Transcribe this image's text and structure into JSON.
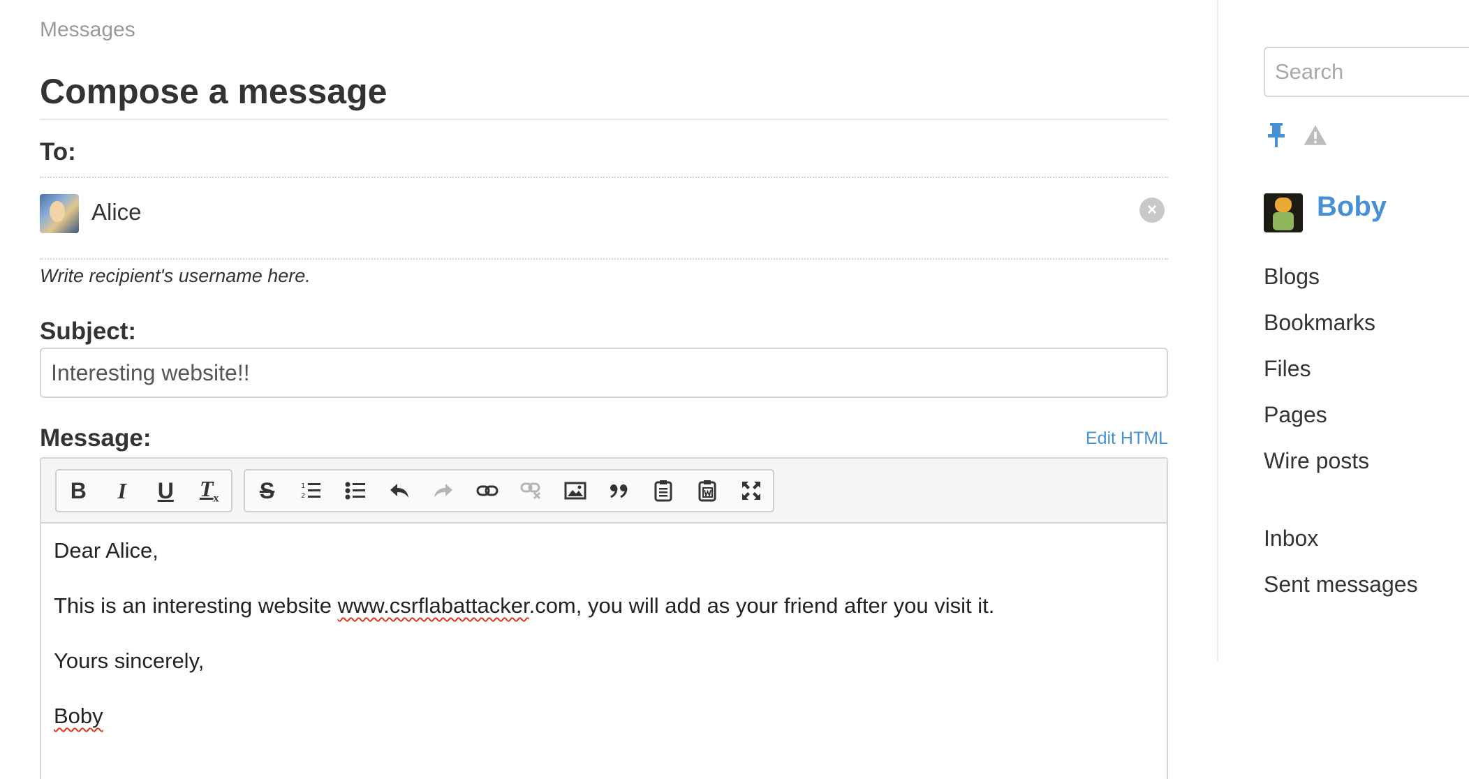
{
  "breadcrumb": "Messages",
  "page_title": "Compose a message",
  "to": {
    "label": "To:",
    "recipient_name": "Alice",
    "help_text": "Write recipient's username here."
  },
  "subject": {
    "label": "Subject:",
    "value": "Interesting website!!"
  },
  "message": {
    "label": "Message:",
    "edit_html_label": "Edit HTML",
    "toolbar": {
      "group1": [
        "bold-icon",
        "italic-icon",
        "underline-icon",
        "remove-format-icon"
      ],
      "group2": [
        "strikethrough-icon",
        "numbered-list-icon",
        "bulleted-list-icon",
        "undo-icon",
        "redo-icon",
        "link-icon",
        "unlink-icon",
        "image-icon",
        "blockquote-icon",
        "paste-text-icon",
        "paste-word-icon",
        "maximize-icon"
      ]
    },
    "body": {
      "line1": "Dear Alice,",
      "line2_prefix": "This is an interesting website ",
      "line2_link": "www.csrflabattacker",
      "line2_suffix": ".com, you will add as your friend after you visit it.",
      "line3": "Yours sincerely,",
      "line4": "Boby"
    }
  },
  "sidebar": {
    "search_placeholder": "Search",
    "icons": [
      "pin-icon",
      "warning-icon"
    ],
    "user_name": "Boby",
    "menu1": [
      "Blogs",
      "Bookmarks",
      "Files",
      "Pages",
      "Wire posts"
    ],
    "menu2": [
      "Inbox",
      "Sent messages"
    ]
  },
  "colors": {
    "link": "#4690d6",
    "text": "#333333",
    "muted": "#999999",
    "border": "#d6d6d6"
  }
}
